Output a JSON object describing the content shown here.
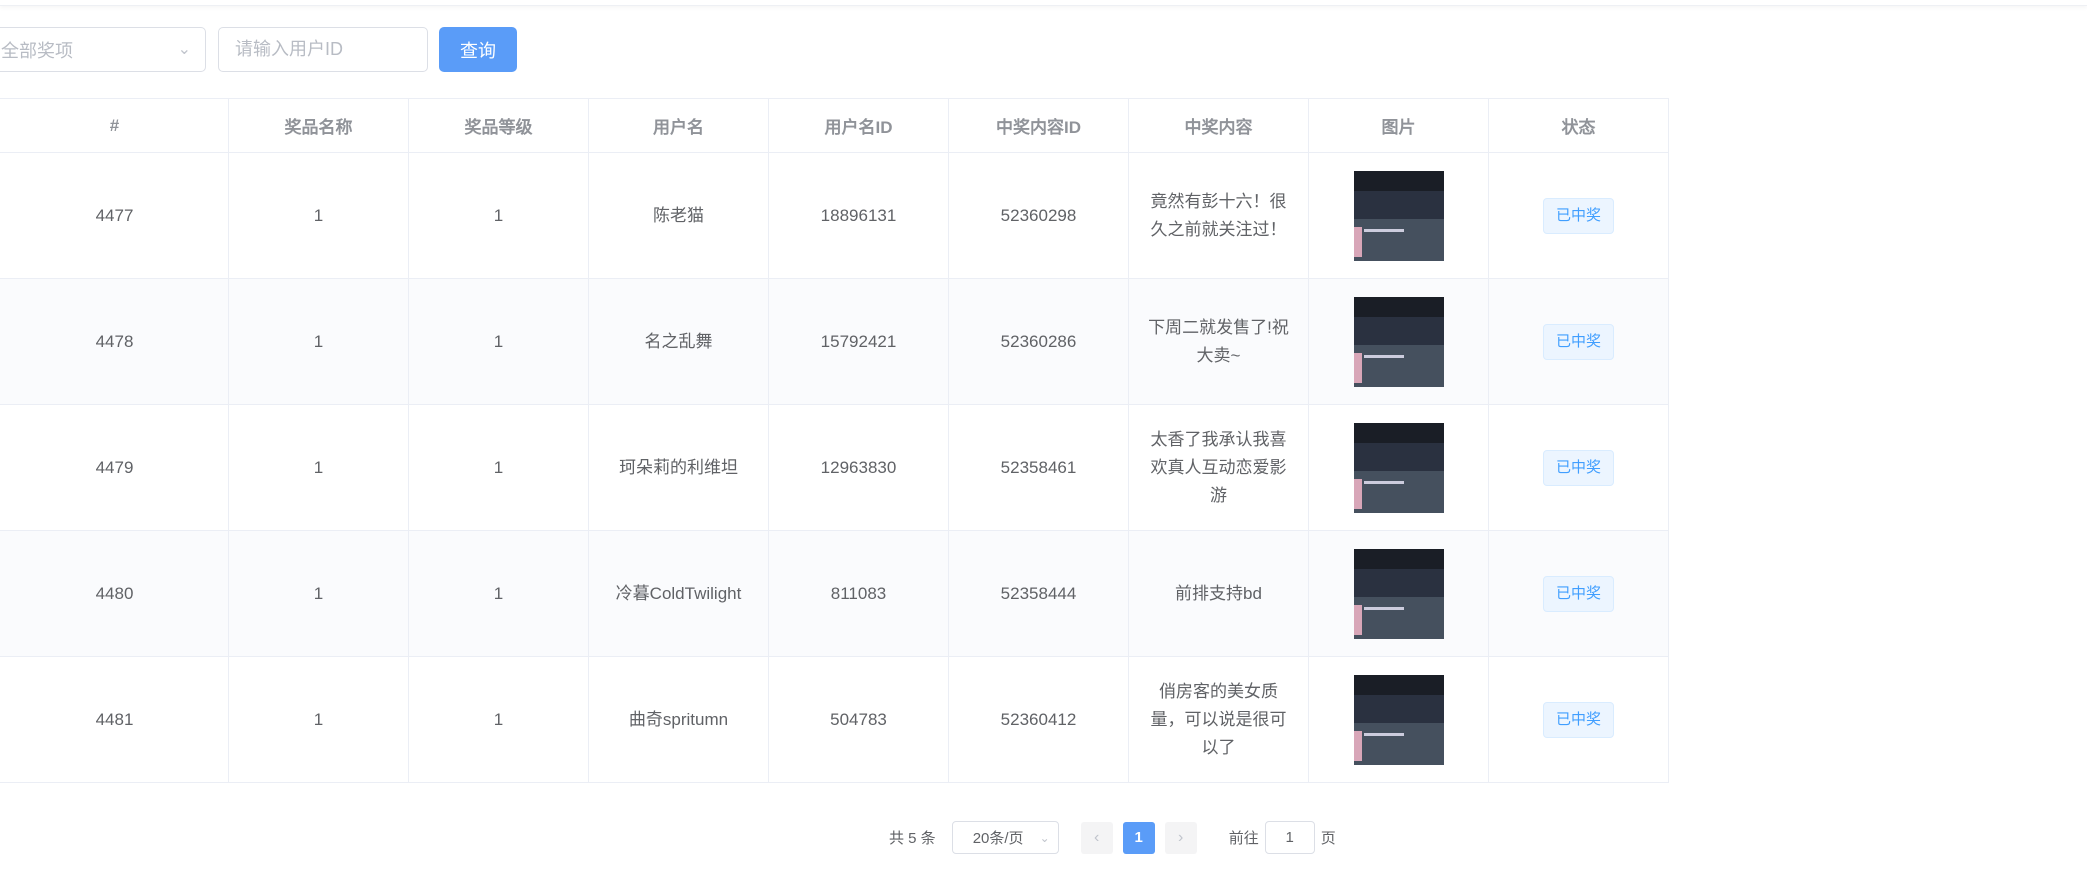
{
  "filters": {
    "prize_select": "全部奖项",
    "user_id_placeholder": "请输入用户ID",
    "query_label": "查询"
  },
  "table": {
    "headers": [
      "#",
      "奖品名称",
      "奖品等级",
      "用户名",
      "用户名ID",
      "中奖内容ID",
      "中奖内容",
      "图片",
      "状态"
    ],
    "rows": [
      {
        "id": "4477",
        "prize_name": "1",
        "prize_level": "1",
        "username": "陈老猫",
        "user_id": "18896131",
        "content_id": "52360298",
        "content": "竟然有彭十六！很久之前就关注过！",
        "status": "已中奖"
      },
      {
        "id": "4478",
        "prize_name": "1",
        "prize_level": "1",
        "username": "名之乱舞",
        "user_id": "15792421",
        "content_id": "52360286",
        "content": "下周二就发售了!祝大卖~",
        "status": "已中奖"
      },
      {
        "id": "4479",
        "prize_name": "1",
        "prize_level": "1",
        "username": "珂朵莉的利维坦",
        "user_id": "12963830",
        "content_id": "52358461",
        "content": "太香了我承认我喜欢真人互动恋爱影游",
        "status": "已中奖"
      },
      {
        "id": "4480",
        "prize_name": "1",
        "prize_level": "1",
        "username": "冷暮ColdTwilight",
        "user_id": "811083",
        "content_id": "52358444",
        "content": "前排支持bd",
        "status": "已中奖"
      },
      {
        "id": "4481",
        "prize_name": "1",
        "prize_level": "1",
        "username": "曲奇spritumn",
        "user_id": "504783",
        "content_id": "52360412",
        "content": "俏房客的美女质量，可以说是很可以了",
        "status": "已中奖"
      }
    ]
  },
  "pagination": {
    "total_label": "共 5 条",
    "page_size": "20条/页",
    "current_page": "1",
    "goto_label": "前往",
    "goto_value": "1",
    "page_suffix": "页"
  }
}
